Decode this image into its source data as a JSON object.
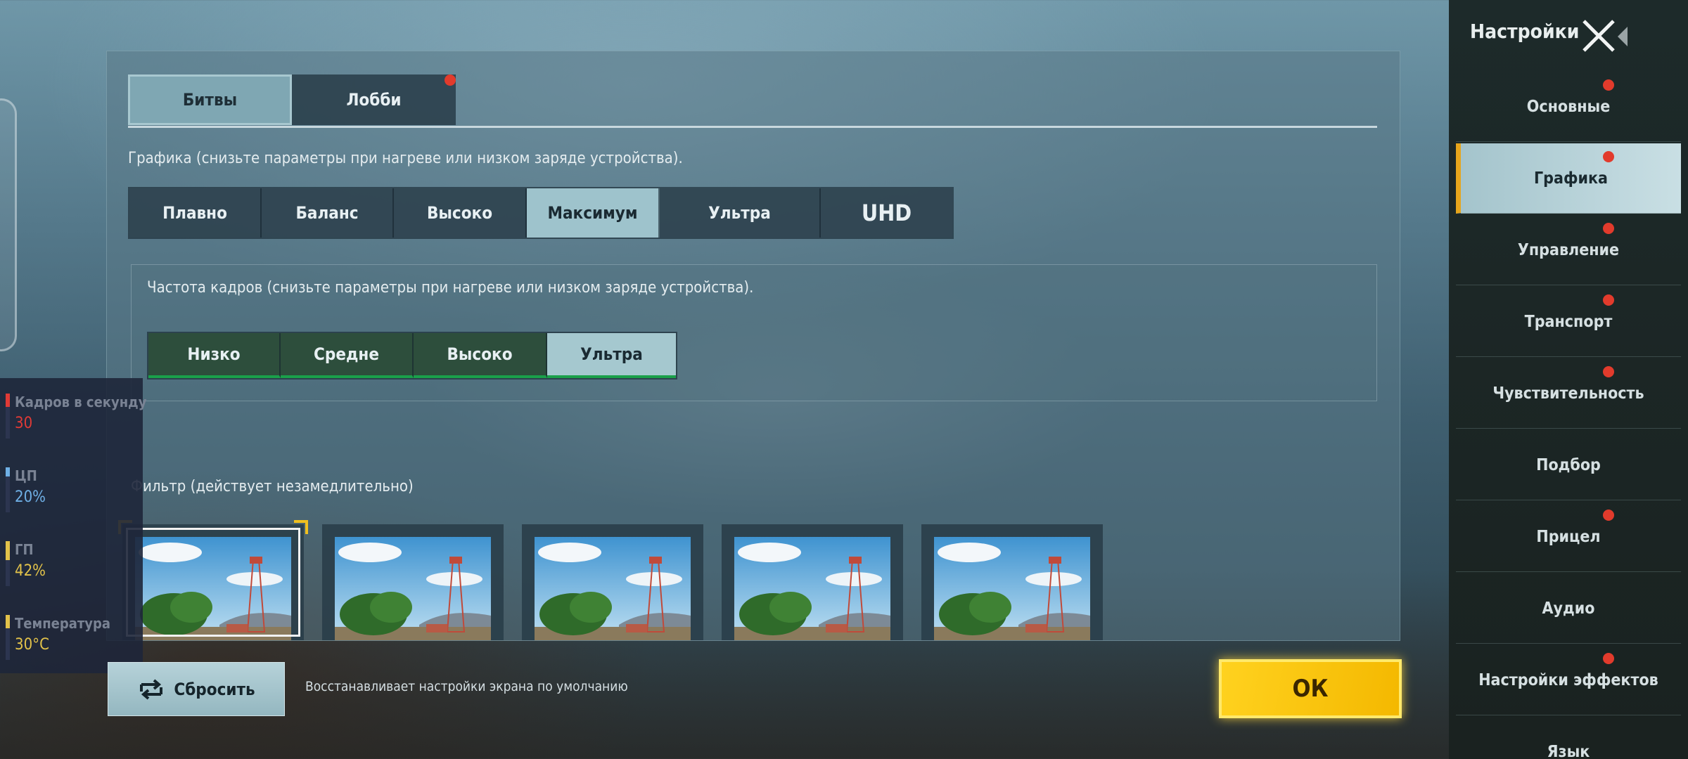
{
  "tabs": [
    {
      "label": "Битвы",
      "active": true,
      "dot": false
    },
    {
      "label": "Лобби",
      "active": false,
      "dot": true
    }
  ],
  "graphics": {
    "label": "Графика (снизьте параметры при нагреве или низком заряде устройства).",
    "options": [
      "Плавно",
      "Баланс",
      "Высоко",
      "Максимум",
      "Ультра",
      "UHD"
    ],
    "selected": "Максимум"
  },
  "framerate": {
    "label": "Частота кадров (снизьте параметры при нагреве или низком заряде устройства).",
    "options": [
      "Низко",
      "Средне",
      "Высоко",
      "Ультра"
    ],
    "selected": "Ультра"
  },
  "filter": {
    "label": "Фильтр (действует незамедлительно)",
    "count": 5,
    "selected_index": 0
  },
  "footer": {
    "reset_label": "Сбросить",
    "reset_note": "Восстанавливает настройки экрана по умолчанию",
    "ok_label": "ОК"
  },
  "perf": [
    {
      "label": "Кадров в секунду",
      "value": "30",
      "color": "#e03a36"
    },
    {
      "label": "ЦП",
      "value": "20%",
      "color": "#6fb0e6"
    },
    {
      "label": "ГП",
      "value": "42%",
      "color": "#e2c24a"
    },
    {
      "label": "Температура",
      "value": "30°C",
      "color": "#e2c24a"
    }
  ],
  "sidebar": {
    "title": "Настройки",
    "items": [
      {
        "label": "Основные",
        "dot": true,
        "active": false
      },
      {
        "label": "Графика",
        "dot": true,
        "active": true
      },
      {
        "label": "Управление",
        "dot": true,
        "active": false
      },
      {
        "label": "Транспорт",
        "dot": true,
        "active": false
      },
      {
        "label": "Чувствительность",
        "dot": true,
        "active": false
      },
      {
        "label": "Подбор",
        "dot": false,
        "active": false
      },
      {
        "label": "Прицел",
        "dot": true,
        "active": false
      },
      {
        "label": "Аудио",
        "dot": false,
        "active": false
      },
      {
        "label": "Настройки эффектов",
        "dot": true,
        "active": false
      },
      {
        "label": "Язык",
        "dot": false,
        "active": false
      }
    ]
  },
  "colors": {
    "accent": "#f4b800",
    "active_tab": "#9ec3cc",
    "notification": "#e23b2c",
    "fps_underline": "#1aa04a"
  }
}
